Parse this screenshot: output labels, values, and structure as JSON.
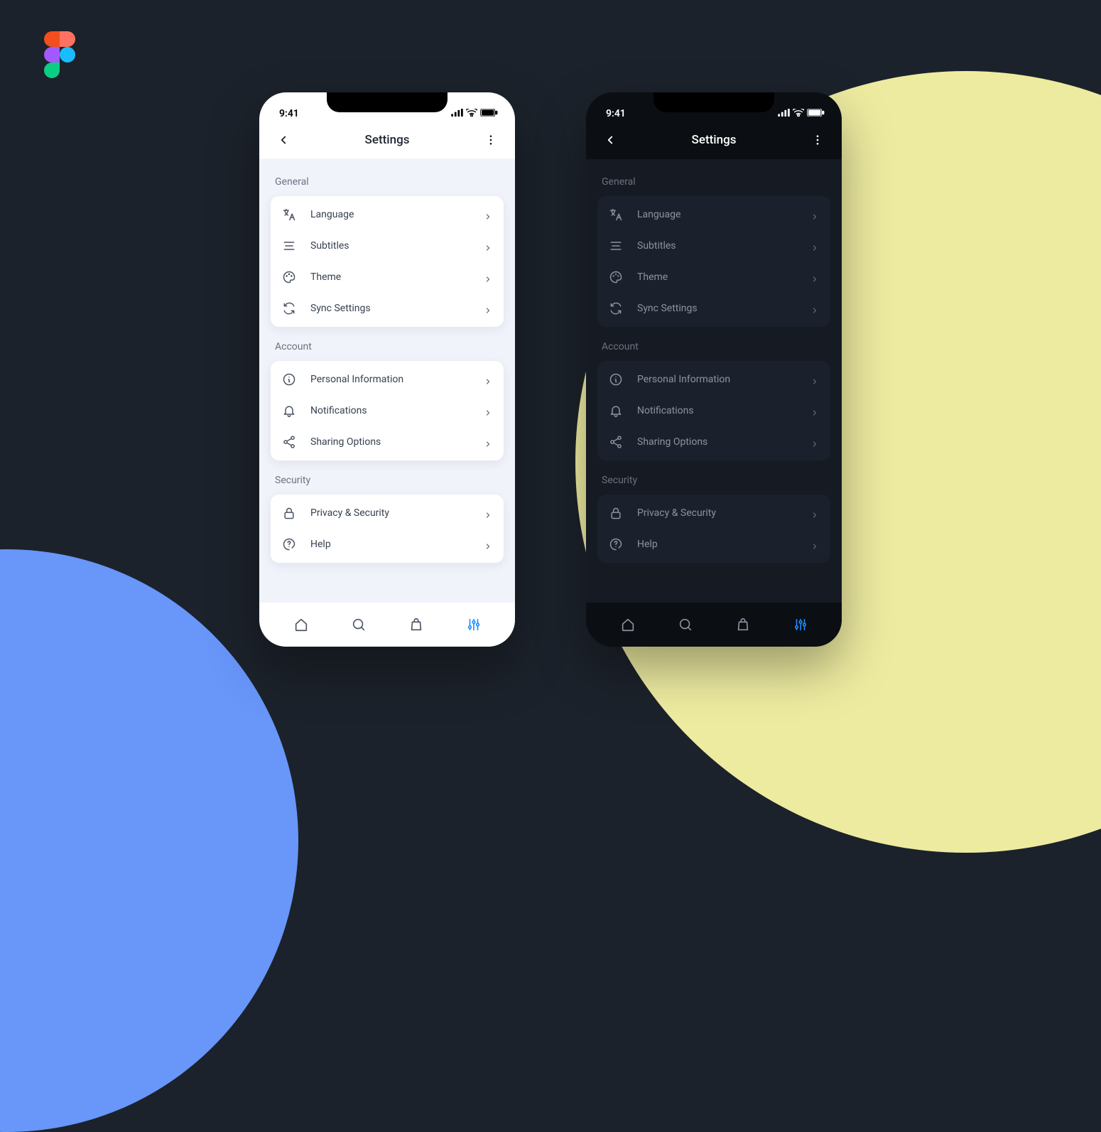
{
  "statusbar": {
    "time": "9:41"
  },
  "header": {
    "title": "Settings"
  },
  "sections": [
    {
      "label": "General",
      "items": [
        {
          "icon": "translate-icon",
          "label": "Language"
        },
        {
          "icon": "subtitles-icon",
          "label": "Subtitles"
        },
        {
          "icon": "palette-icon",
          "label": "Theme"
        },
        {
          "icon": "sync-icon",
          "label": "Sync Settings"
        }
      ]
    },
    {
      "label": "Account",
      "items": [
        {
          "icon": "info-icon",
          "label": "Personal Information"
        },
        {
          "icon": "bell-icon",
          "label": "Notifications"
        },
        {
          "icon": "share-icon",
          "label": "Sharing Options"
        }
      ]
    },
    {
      "label": "Security",
      "items": [
        {
          "icon": "lock-icon",
          "label": "Privacy  & Security"
        },
        {
          "icon": "help-icon",
          "label": "Help"
        }
      ]
    }
  ],
  "bottombar": {
    "items": [
      {
        "icon": "home-icon",
        "active": false
      },
      {
        "icon": "search-icon",
        "active": false
      },
      {
        "icon": "bag-icon",
        "active": false
      },
      {
        "icon": "sliders-icon",
        "active": true
      }
    ]
  },
  "themes": [
    "light",
    "dark"
  ],
  "colors": {
    "accent": "#1c8cff",
    "bg_dark": "#1c222b",
    "circle_yellow": "#edeba0",
    "circle_blue": "#6896f9"
  }
}
